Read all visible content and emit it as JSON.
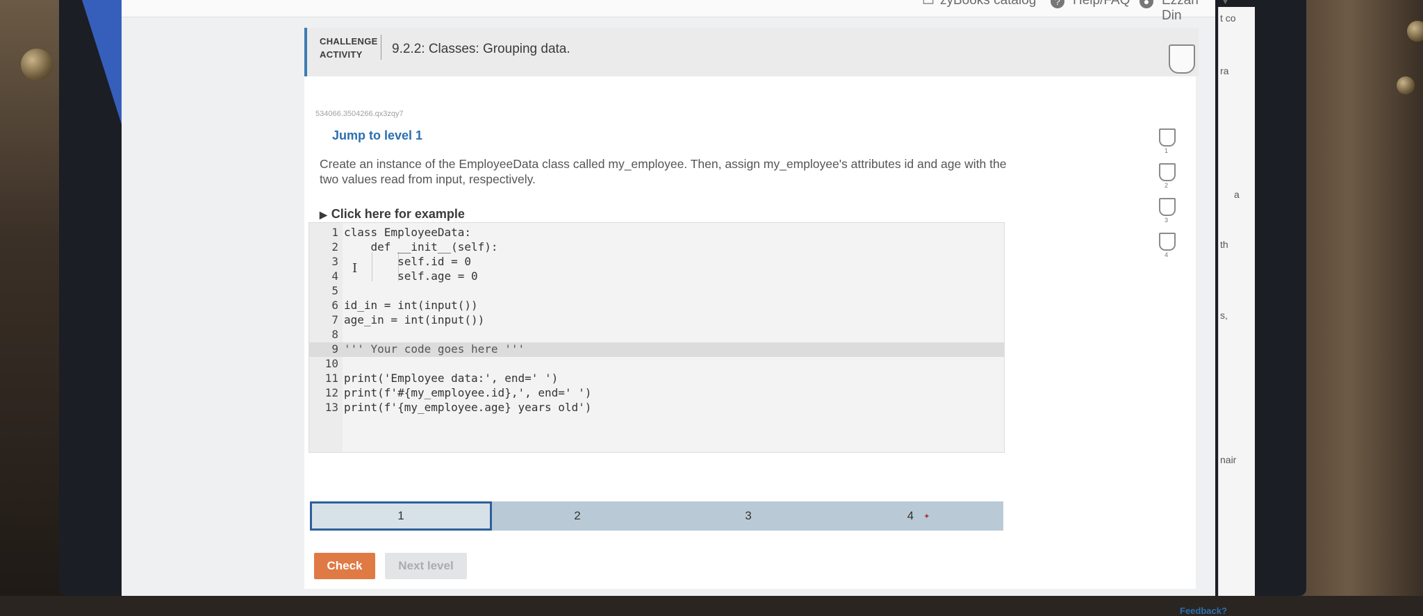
{
  "topbar": {
    "catalog_label": "zyBooks catalog",
    "help_label": "Help/FAQ",
    "user_name": "Ezzan Din"
  },
  "sidebar_right_fragments": [
    "t co",
    "ra",
    "a",
    "th",
    "s,",
    "nair"
  ],
  "activity": {
    "type_label_line1": "CHALLENGE",
    "type_label_line2": "ACTIVITY",
    "title": "9.2.2: Classes: Grouping data.",
    "id": "534066.3504266.qx3zqy7",
    "jump_label": "Jump to level 1",
    "instruction": "Create an instance of the EmployeeData class called my_employee. Then, assign my_employee's attributes id and age with the two values read from input, respectively.",
    "example_label": "Click here for example",
    "level_markers": [
      "1",
      "2",
      "3",
      "4"
    ]
  },
  "code": [
    {
      "n": "1",
      "text": "class EmployeeData:"
    },
    {
      "n": "2",
      "text": "    def __init__(self):"
    },
    {
      "n": "3",
      "text": "        self.id = 0"
    },
    {
      "n": "4",
      "text": "        self.age = 0"
    },
    {
      "n": "5",
      "text": ""
    },
    {
      "n": "6",
      "text": "id_in = int(input())"
    },
    {
      "n": "7",
      "text": "age_in = int(input())"
    },
    {
      "n": "8",
      "text": ""
    },
    {
      "n": "9",
      "text": "''' Your code goes here '''"
    },
    {
      "n": "10",
      "text": ""
    },
    {
      "n": "11",
      "text": "print('Employee data:', end=' ')"
    },
    {
      "n": "12",
      "text": "print(f'#{my_employee.id},', end=' ')"
    },
    {
      "n": "13",
      "text": "print(f'{my_employee.age} years old')"
    }
  ],
  "progress": {
    "levels": [
      "1",
      "2",
      "3",
      "4"
    ],
    "current": "1"
  },
  "buttons": {
    "check": "Check",
    "next": "Next level"
  },
  "feedback_label": "Feedback?",
  "colors": {
    "accent_blue": "#2a6fb0",
    "check_orange": "#e07a45",
    "progress_bar": "#b9cad6",
    "current_level_border": "#2d5f9a"
  }
}
